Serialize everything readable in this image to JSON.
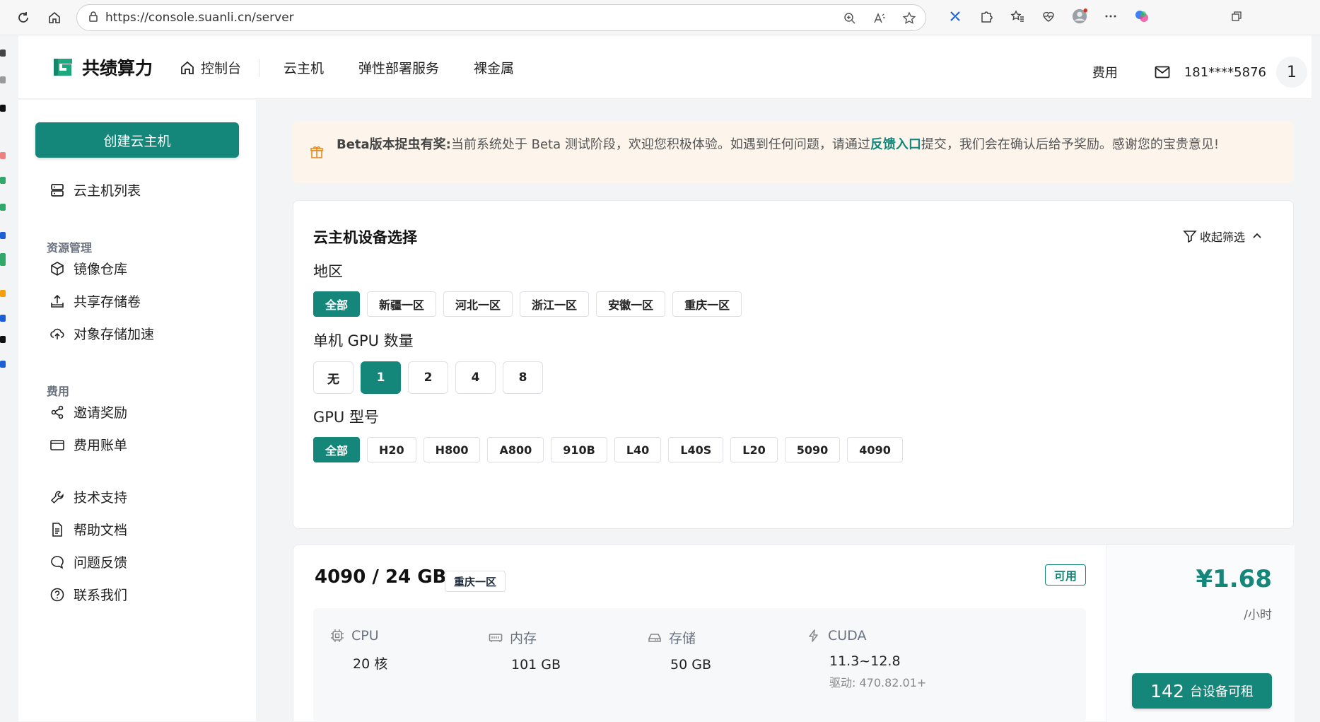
{
  "browser": {
    "url": "https://console.suanli.cn/server"
  },
  "colors": {
    "accent": "#15877a",
    "banner_bg": "#fdf5ec"
  },
  "header": {
    "logo_text": "共绩算力",
    "nav": [
      {
        "label": "控制台",
        "icon": "home-icon"
      },
      {
        "label": "云主机"
      },
      {
        "label": "弹性部署服务"
      },
      {
        "label": "裸金属"
      }
    ],
    "billing_label": "费用",
    "phone": "181****5876",
    "avatar_text": "1"
  },
  "sidebar": {
    "create_label": "创建云主机",
    "server_list": "云主机列表",
    "groups": {
      "resources": "资源管理",
      "billing": "费用"
    },
    "resources": [
      "镜像仓库",
      "共享存储卷",
      "对象存储加速"
    ],
    "billing": [
      "邀请奖励",
      "费用账单"
    ],
    "support": [
      "技术支持",
      "帮助文档",
      "问题反馈",
      "联系我们"
    ]
  },
  "banner": {
    "title": "Beta版本捉虫有奖:",
    "text_before": "当前系统处于 Beta 测试阶段，欢迎您积极体验。如遇到任何问题，请通过",
    "link": "反馈入口",
    "text_after": "提交，我们会在确认后给予奖励。感谢您的宝贵意见!"
  },
  "filter": {
    "title": "云主机设备选择",
    "collapse_label": "收起筛选",
    "region_label": "地区",
    "regions": [
      "全部",
      "新疆一区",
      "河北一区",
      "浙江一区",
      "安徽一区",
      "重庆一区"
    ],
    "region_selected": 0,
    "gpu_count_label": "单机 GPU 数量",
    "gpu_counts": [
      "无",
      "1",
      "2",
      "4",
      "8"
    ],
    "gpu_count_selected": 1,
    "gpu_model_label": "GPU 型号",
    "gpu_models": [
      "全部",
      "H20",
      "H800",
      "A800",
      "910B",
      "L40",
      "L40S",
      "L20",
      "5090",
      "4090"
    ],
    "gpu_model_selected": 0
  },
  "server": {
    "title": "4090 / 24 GB",
    "region": "重庆一区",
    "status": "可用",
    "specs": {
      "cpu_label": "CPU",
      "cpu_value": "20 核",
      "mem_label": "内存",
      "mem_value": "101 GB",
      "storage_label": "存储",
      "storage_value": "50 GB",
      "cuda_label": "CUDA",
      "cuda_value": "11.3~12.8",
      "driver": "驱动: 470.82.01+"
    },
    "price": "¥1.68",
    "price_unit": "/小时",
    "available_count": "142",
    "available_label": "台设备可租"
  }
}
